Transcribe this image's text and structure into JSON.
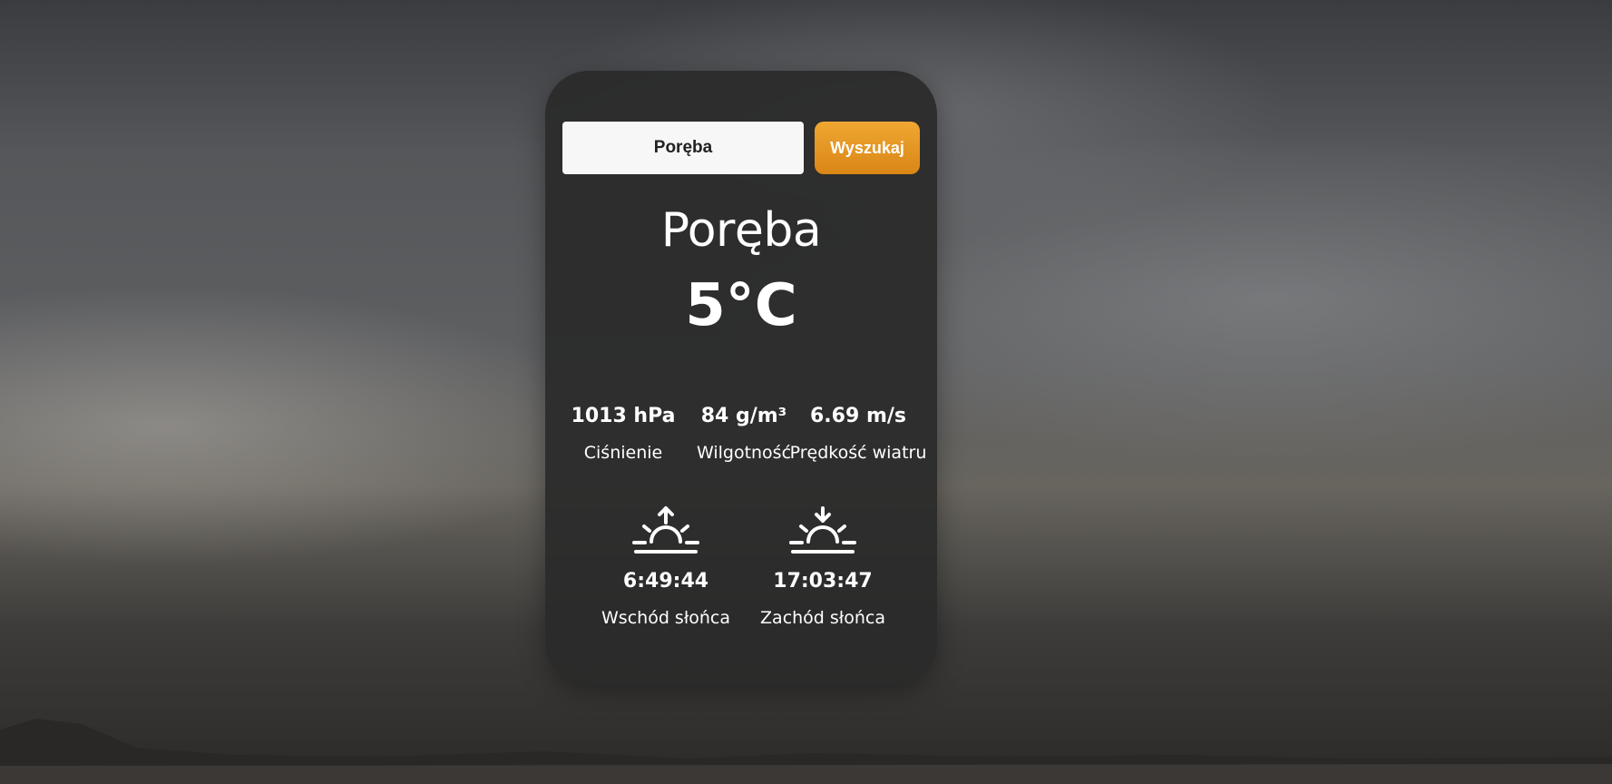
{
  "search": {
    "value": "Poręba",
    "button_label": "Wyszukaj"
  },
  "weather": {
    "city": "Poręba",
    "temperature": "5°C",
    "stats": [
      {
        "value": "1013 hPa",
        "label": "Ciśnienie"
      },
      {
        "value": "84 g/m³",
        "label": "Wilgotność"
      },
      {
        "value": "6.69 m/s",
        "label": "Prędkość wiatru"
      }
    ],
    "sunrise": {
      "time": "6:49:44",
      "label": "Wschód słońca",
      "icon": "sunrise-icon"
    },
    "sunset": {
      "time": "17:03:47",
      "label": "Zachód słońca",
      "icon": "sunset-icon"
    }
  },
  "colors": {
    "card_background": "#2a2a2a",
    "button_accent": "#e8961f",
    "text": "#ffffff"
  }
}
